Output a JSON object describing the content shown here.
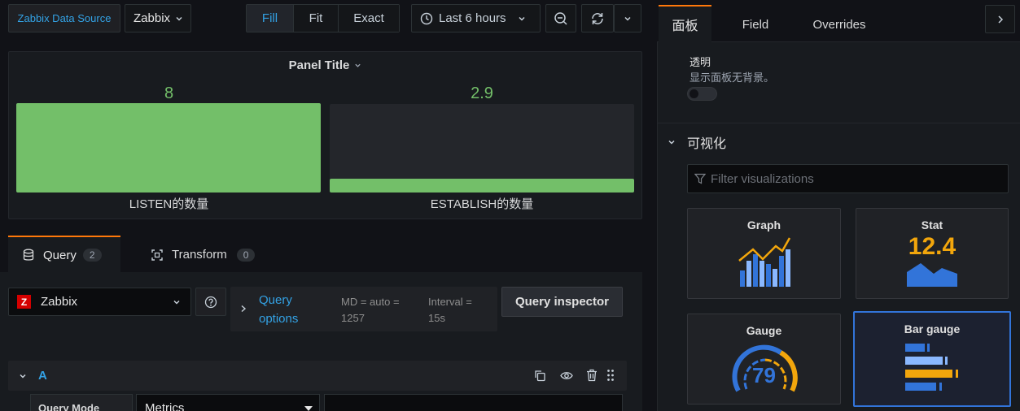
{
  "topbar": {
    "datasource_label": "Zabbix Data Source",
    "datasource_value": "Zabbix",
    "fill": "Fill",
    "fit": "Fit",
    "exact": "Exact",
    "time_range": "Last 6 hours"
  },
  "panel": {
    "title": "Panel Title",
    "bars": [
      {
        "value": "8",
        "label": "LISTEN的数量",
        "fill_fraction": 1.0
      },
      {
        "value": "2.9",
        "label": "ESTABLISH的数量",
        "fill_fraction": 0.16
      }
    ]
  },
  "query_tabs": [
    {
      "label": "Query",
      "count": "2"
    },
    {
      "label": "Transform",
      "count": "0"
    }
  ],
  "query_row": {
    "datasource": "Zabbix",
    "options_label": "Query options",
    "md": "MD = auto = 1257",
    "interval": "Interval = 15s",
    "inspector": "Query inspector"
  },
  "query_a": {
    "letter": "A",
    "mode_label": "Query Mode",
    "mode_value": "Metrics"
  },
  "right": {
    "tabs": [
      "面板",
      "Field",
      "Overrides"
    ],
    "transparent_title": "透明",
    "transparent_desc": "显示面板无背景。",
    "viz_section": "可视化",
    "filter_placeholder": "Filter visualizations",
    "viz": [
      {
        "name": "Graph"
      },
      {
        "name": "Stat",
        "value": "12.4"
      },
      {
        "name": "Gauge",
        "value": "79"
      },
      {
        "name": "Bar gauge"
      }
    ]
  },
  "colors": {
    "green": "#73bf69",
    "blue": "#33a2e5",
    "accent": "#ff780a",
    "yellow": "#f2cc0c",
    "selected": "#3274d9"
  }
}
